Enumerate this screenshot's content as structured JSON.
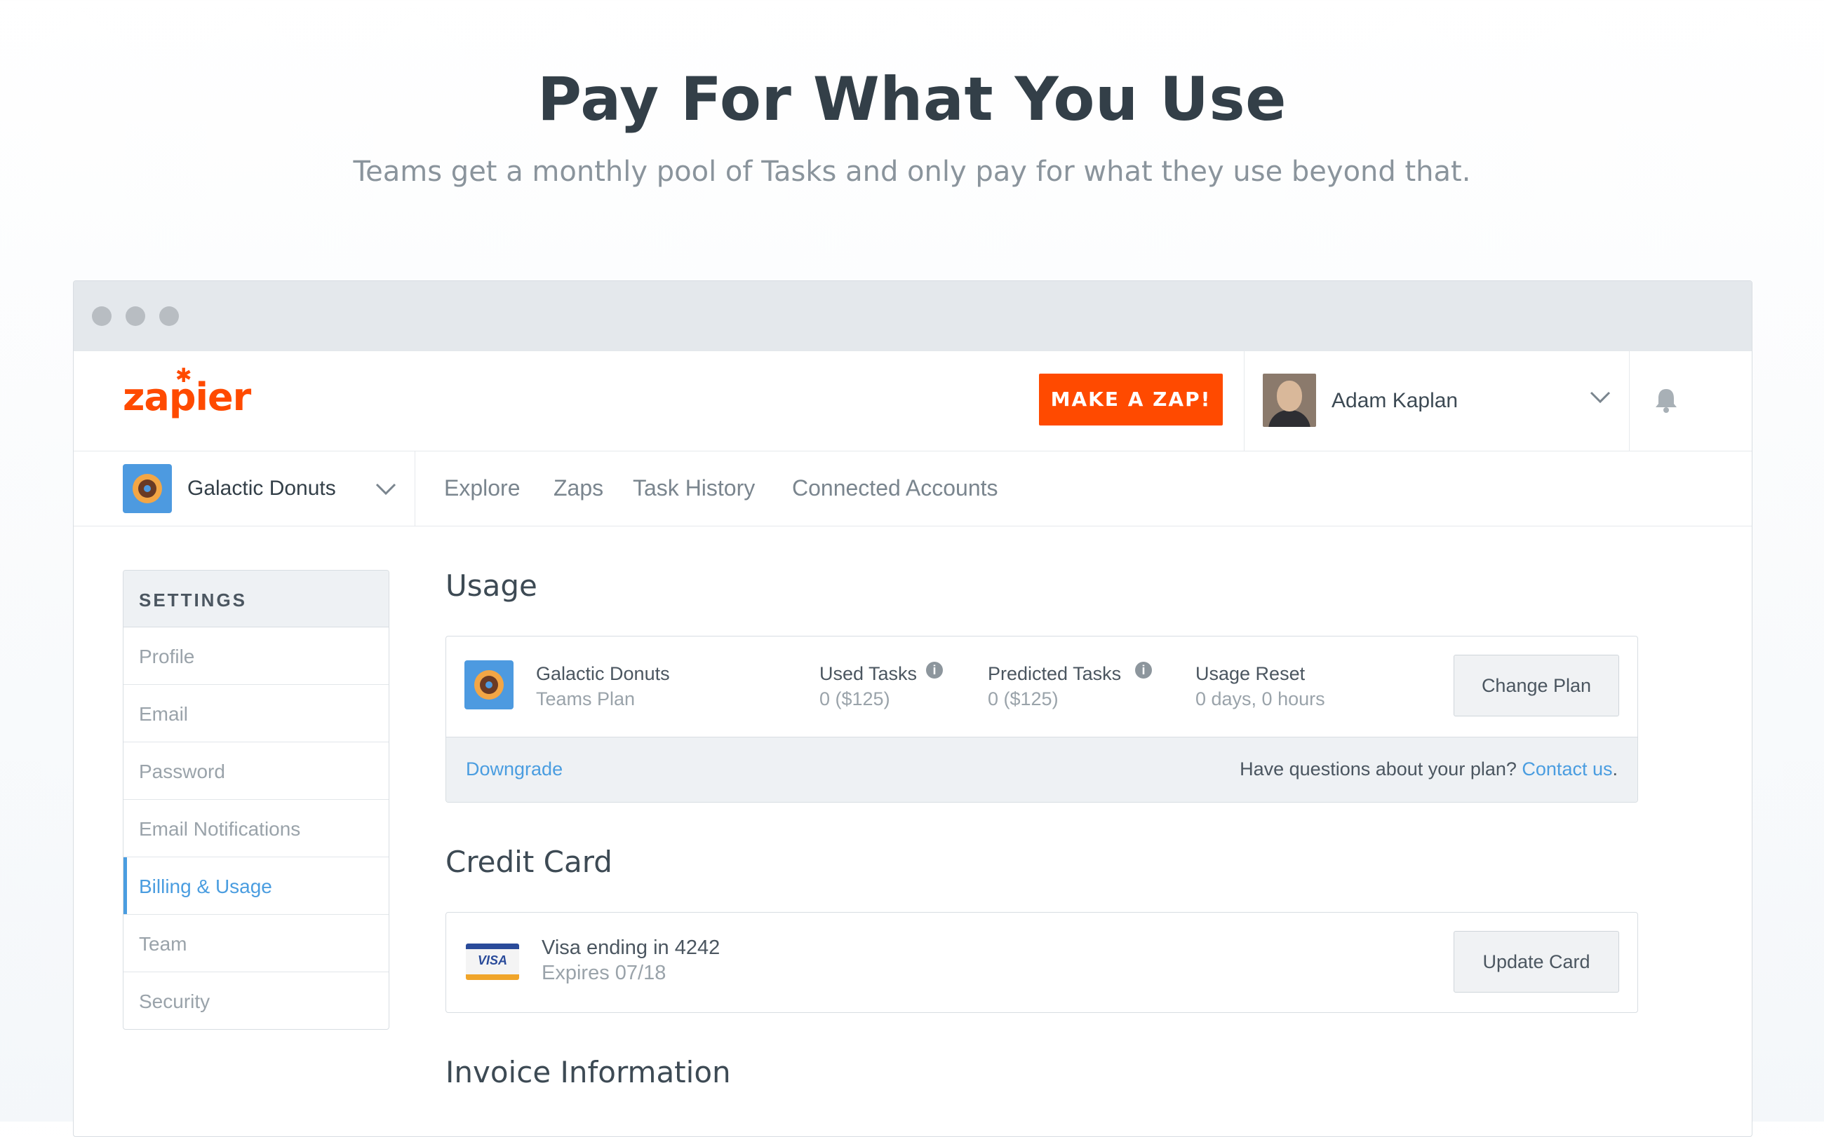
{
  "hero": {
    "title": "Pay For What You Use",
    "subtitle": "Teams get a monthly pool of Tasks and only pay for what they use beyond that."
  },
  "header": {
    "logo": "zapier",
    "make_zap": "MAKE A ZAP!",
    "user_name": "Adam Kaplan"
  },
  "subnav": {
    "team_name": "Galactic Donuts",
    "links": [
      "Explore",
      "Zaps",
      "Task History",
      "Connected Accounts"
    ]
  },
  "settings": {
    "heading": "SETTINGS",
    "items": [
      "Profile",
      "Email",
      "Password",
      "Email Notifications",
      "Billing & Usage",
      "Team",
      "Security"
    ],
    "active": "Billing & Usage"
  },
  "usage": {
    "title": "Usage",
    "team_name": "Galactic Donuts",
    "plan": "Teams Plan",
    "used_label": "Used Tasks",
    "used_value": "0 ($125)",
    "predicted_label": "Predicted Tasks",
    "predicted_value": "0 ($125)",
    "reset_label": "Usage Reset",
    "reset_value": "0 days, 0 hours",
    "change_plan": "Change Plan",
    "downgrade": "Downgrade",
    "questions": "Have questions about your plan?",
    "contact": "Contact us",
    "period": "."
  },
  "credit_card": {
    "title": "Credit Card",
    "card_brand": "VISA",
    "card_line": "Visa ending in 4242",
    "expires": "Expires 07/18",
    "update": "Update Card"
  },
  "invoice": {
    "title": "Invoice Information"
  },
  "colors": {
    "brand": "#ff4a00",
    "link": "#4a9de0",
    "text": "#3d4a54"
  }
}
